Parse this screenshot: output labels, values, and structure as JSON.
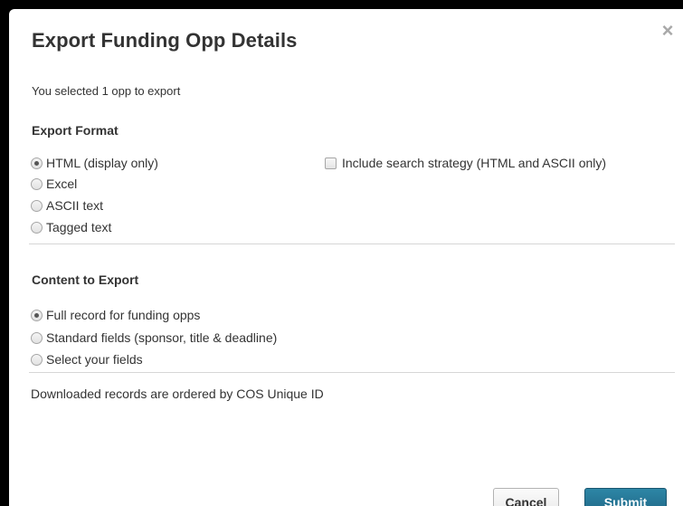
{
  "dialog": {
    "title": "Export Funding Opp Details",
    "close_glyph": "×",
    "selected_text": "You selected 1 opp to export"
  },
  "export_format": {
    "heading": "Export Format",
    "options": [
      {
        "label": "HTML (display only)",
        "checked": true
      },
      {
        "label": "Excel",
        "checked": false
      },
      {
        "label": "ASCII text",
        "checked": false
      },
      {
        "label": "Tagged text",
        "checked": false
      }
    ],
    "include_search_strategy": {
      "label": "Include search strategy (HTML and ASCII only)",
      "checked": false
    }
  },
  "content_to_export": {
    "heading": "Content to Export",
    "options": [
      {
        "label": "Full record for funding opps",
        "checked": true
      },
      {
        "label": "Standard fields (sponsor, title & deadline)",
        "checked": false
      },
      {
        "label": "Select your fields",
        "checked": false
      }
    ]
  },
  "note": "Downloaded records are ordered by COS Unique ID",
  "buttons": {
    "cancel_label": "Cancel",
    "submit_label": "Submit"
  },
  "colors": {
    "submit_button": "#216b8b",
    "overlay": "#000000",
    "text": "#333333"
  }
}
